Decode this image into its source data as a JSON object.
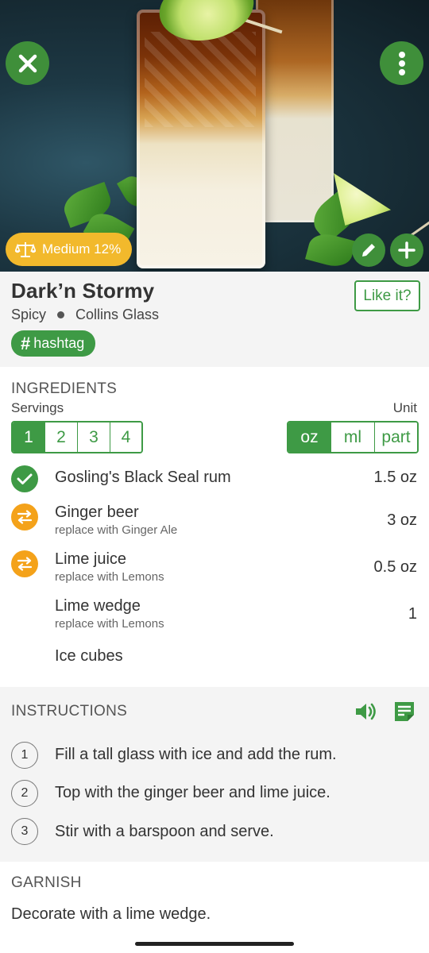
{
  "hero": {
    "strength_label": "Medium 12%",
    "icons": {
      "close": "close-icon",
      "menu": "more-vert-icon",
      "edit": "pencil-icon",
      "add": "plus-icon",
      "strength": "scale-icon"
    },
    "colors": {
      "button": "#3f8f3a",
      "badge": "#f2b92c"
    }
  },
  "recipe": {
    "name": "Dark’n Stormy",
    "taste": "Spicy",
    "glass": "Collins Glass",
    "like_label": "Like it?",
    "hashtag": "hashtag",
    "hashtag_symbol": "#"
  },
  "ingredients": {
    "section_title": "INGREDIENTS",
    "servings_label": "Servings",
    "unit_label": "Unit",
    "servings_options": [
      "1",
      "2",
      "3",
      "4"
    ],
    "servings_selected": "1",
    "unit_options": [
      "oz",
      "ml",
      "part"
    ],
    "unit_selected": "oz",
    "items": [
      {
        "name": "Gosling's Black Seal rum",
        "sub": "",
        "amount": "1.5 oz",
        "status": "check-circle-icon"
      },
      {
        "name": "Ginger beer",
        "sub": "replace with Ginger Ale",
        "amount": "3 oz",
        "status": "swap-icon"
      },
      {
        "name": "Lime juice",
        "sub": "replace with Lemons",
        "amount": "0.5 oz",
        "status": "swap-icon"
      },
      {
        "name": "Lime wedge",
        "sub": "replace with Lemons",
        "amount": "1",
        "status": ""
      },
      {
        "name": "Ice cubes",
        "sub": "",
        "amount": "",
        "status": ""
      }
    ],
    "accent_color": "#3e9a45",
    "swap_color": "#f4a21a"
  },
  "instructions": {
    "section_title": "INSTRUCTIONS",
    "icons": {
      "speak": "volume-icon",
      "notes": "note-icon"
    },
    "steps": [
      {
        "num": "1",
        "text": "Fill a tall glass with ice and add the rum."
      },
      {
        "num": "2",
        "text": "Top with the ginger beer and lime juice."
      },
      {
        "num": "3",
        "text": "Stir with a barspoon and serve."
      }
    ]
  },
  "garnish": {
    "section_title": "GARNISH",
    "text": "Decorate with a lime wedge."
  }
}
